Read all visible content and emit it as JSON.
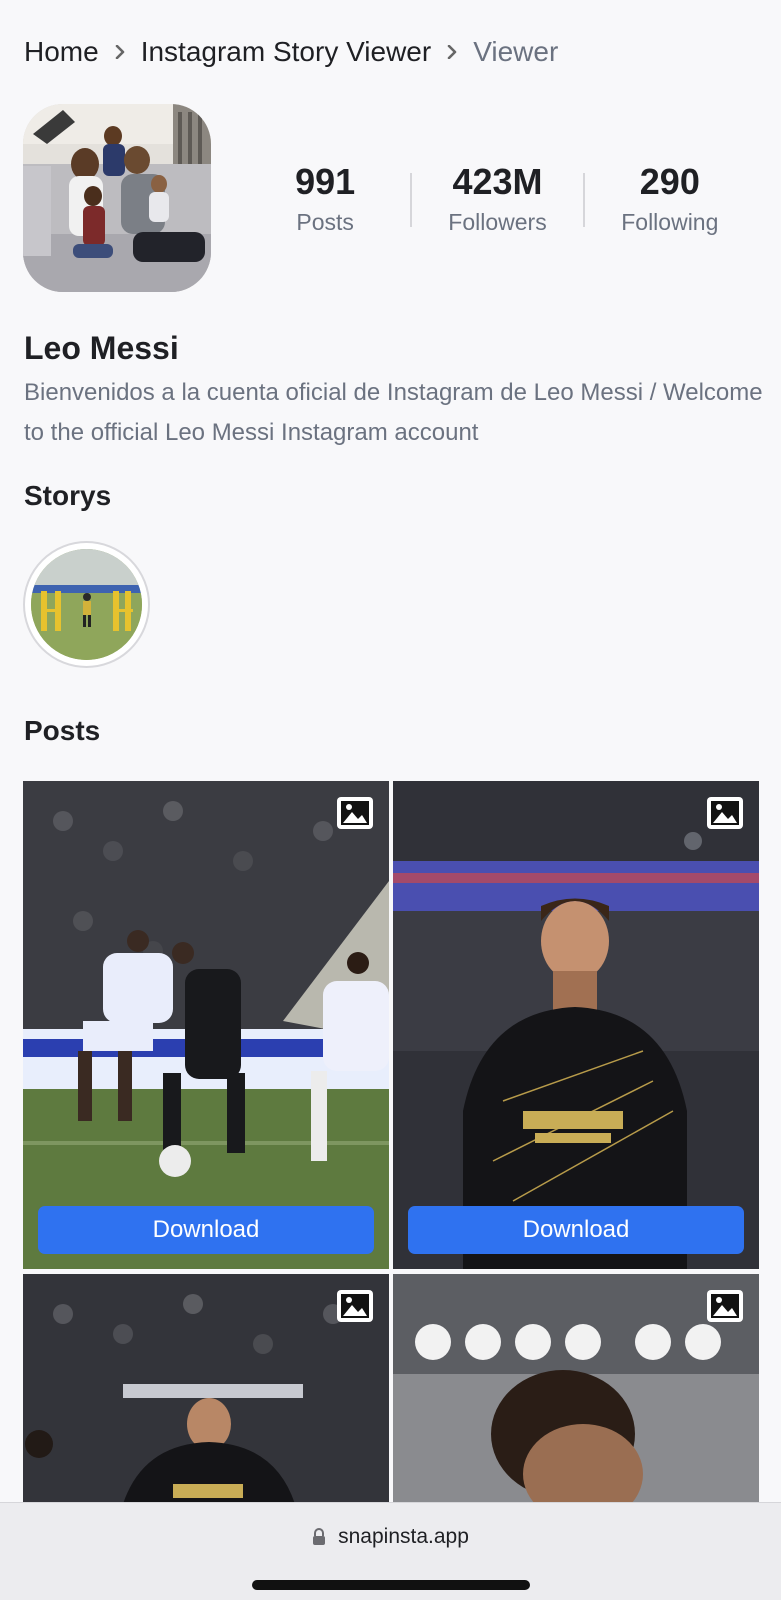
{
  "breadcrumb": {
    "items": [
      {
        "label": "Home"
      },
      {
        "label": "Instagram Story Viewer"
      },
      {
        "label": "Viewer"
      }
    ]
  },
  "profile": {
    "name": "Leo Messi",
    "bio": "Bienvenidos a la cuenta oficial de Instagram de Leo Messi / Welcome to the official Leo Messi Instagram account",
    "stats": [
      {
        "value": "991",
        "label": "Posts"
      },
      {
        "value": "423M",
        "label": "Followers"
      },
      {
        "value": "290",
        "label": "Following"
      }
    ]
  },
  "stories": {
    "title": "Storys"
  },
  "posts": {
    "title": "Posts",
    "items": [
      {
        "download_label": "Download",
        "media_icon": "image-icon"
      },
      {
        "download_label": "Download",
        "media_icon": "image-icon"
      },
      {
        "download_label": "",
        "media_icon": "image-icon"
      },
      {
        "download_label": "",
        "media_icon": "image-icon"
      }
    ]
  },
  "browser": {
    "url": "snapinsta.app",
    "lock_icon": "lock-icon"
  },
  "colors": {
    "accent": "#2f72f0",
    "muted_text": "#6b7280",
    "background": "#f8f8fa"
  }
}
